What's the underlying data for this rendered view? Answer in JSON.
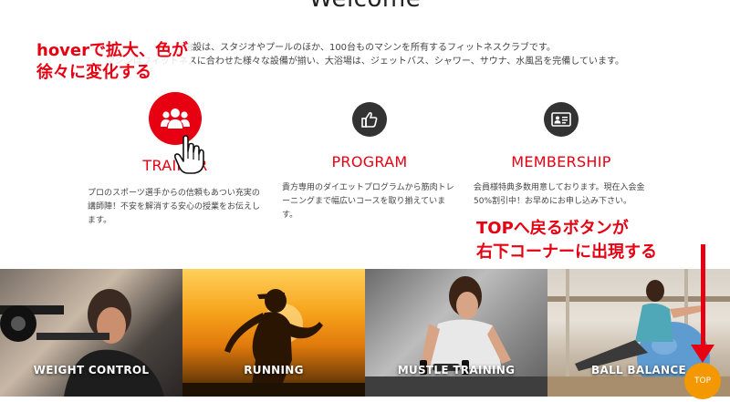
{
  "header": {
    "title": "Welcome"
  },
  "intro": {
    "line1": "当施設は、スタジオやプールのほか、100台ものマシンを所有するフィットネスクラブです。",
    "line2": "マシンはフィットネスに合わせた様々な設備が揃い、大浴場は、ジェットバス、シャワー、サウナ、水風呂を完備しています。"
  },
  "annotations": {
    "hover_line1": "hoverで拡大、色が",
    "hover_line2": "徐々に変化する",
    "top_line1": "TOPへ戻るボタンが",
    "top_line2": "右下コーナーに出現する"
  },
  "features": [
    {
      "icon": "group-icon",
      "title": "TRAINER",
      "desc": "プロのスポーツ選手からの信頼もあつい充実の講師陣！不安を解消する安心の授業をお伝えします。"
    },
    {
      "icon": "thumbs-up-icon",
      "title": "PROGRAM",
      "desc": "貴方専用のダイエットプログラムから筋肉トレーニングまで幅広いコースを取り揃えています。"
    },
    {
      "icon": "id-card-icon",
      "title": "MEMBERSHIP",
      "desc": "会員様特典多数用意しております。現在入会金50%割引中！お早めにお申し込み下さい。"
    }
  ],
  "gallery": [
    {
      "label": "WEIGHT CONTROL"
    },
    {
      "label": "RUNNING"
    },
    {
      "label": "MUSTLE TRAINING"
    },
    {
      "label": "BALL BALANCE"
    }
  ],
  "top_button": {
    "label": "TOP"
  },
  "colors": {
    "accent": "#e60012",
    "dark_icon": "#333333",
    "top_button": "#f39800"
  }
}
